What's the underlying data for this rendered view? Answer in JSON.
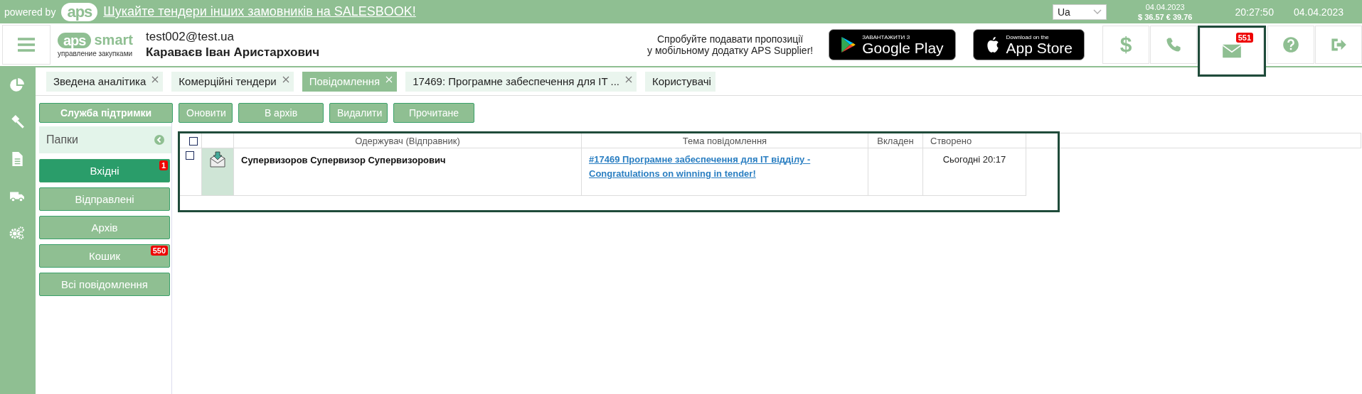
{
  "promo_bar": {
    "powered_by": "powered by",
    "logo": "aps",
    "link": "Шукайте тендери інших замовників на SALESBOOK!",
    "language": "Ua",
    "rates_date": "04.04.2023",
    "rates": "$ 36.57  € 39.76",
    "time": "20:27:50",
    "date": "04.04.2023"
  },
  "header": {
    "logo": "aps",
    "logo_word": "smart",
    "logo_tagline": "управление закупками",
    "email": "test002@test.ua",
    "user_name": "Караваєв Іван Аристархович",
    "app_promo": "Спробуйте подавати пропозиції\nу мобільному додатку APS Supplier!",
    "stores": [
      {
        "kind": "google",
        "small": "ЗАВАНТАЖИТИ З",
        "big": "Google Play"
      },
      {
        "kind": "apple",
        "small": "Download on the",
        "big": "App Store"
      }
    ],
    "actions": [
      {
        "kind": "dollar",
        "glyph": "$",
        "highlighted": false
      },
      {
        "kind": "phone",
        "highlighted": false
      },
      {
        "kind": "mail",
        "badge": "551",
        "highlighted": true
      },
      {
        "kind": "help",
        "highlighted": false
      },
      {
        "kind": "logout",
        "highlighted": false
      }
    ]
  },
  "rail": [
    {
      "kind": "chart"
    },
    {
      "kind": "gavel"
    },
    {
      "kind": "document"
    },
    {
      "kind": "truck"
    },
    {
      "kind": "gears"
    }
  ],
  "tabs": [
    {
      "label": "Зведена аналітика",
      "selected": false,
      "closable": true
    },
    {
      "label": "Комерційні тендери",
      "selected": false,
      "closable": true
    },
    {
      "label": "Повідомлення",
      "selected": true,
      "closable": true
    },
    {
      "label": "17469: Програмне забеспечення для IT ...",
      "selected": false,
      "closable": true
    },
    {
      "label": "Користувачі",
      "selected": false,
      "closable": false
    }
  ],
  "support_button": "Служба підтримки",
  "toolbar": [
    "Оновити",
    "В архів",
    "Видалити",
    "Прочитане"
  ],
  "folders": {
    "title": "Папки",
    "items": [
      {
        "label": "Вхідні",
        "selected": true,
        "badge": "1"
      },
      {
        "label": "Відправлені",
        "selected": false
      },
      {
        "label": "Архів",
        "selected": false
      },
      {
        "label": "Кошик",
        "selected": false,
        "badge": "550"
      },
      {
        "label": "Всі повідомлення",
        "selected": false
      }
    ]
  },
  "table": {
    "highlighted": true,
    "all_checked": false,
    "columns": [
      "Одержувач (Відправник)",
      "Тема повідомлення",
      "Вкладен",
      "Створено"
    ],
    "rows": [
      {
        "checked": false,
        "unread": true,
        "sender": "Супервизоров Супервизор Супервизорович",
        "subject": "#17469 Програмне забеспечення для IT відділу - Congratulations on winning in tender!",
        "attachments": "",
        "created": "Сьогодні 20:17"
      }
    ]
  }
}
